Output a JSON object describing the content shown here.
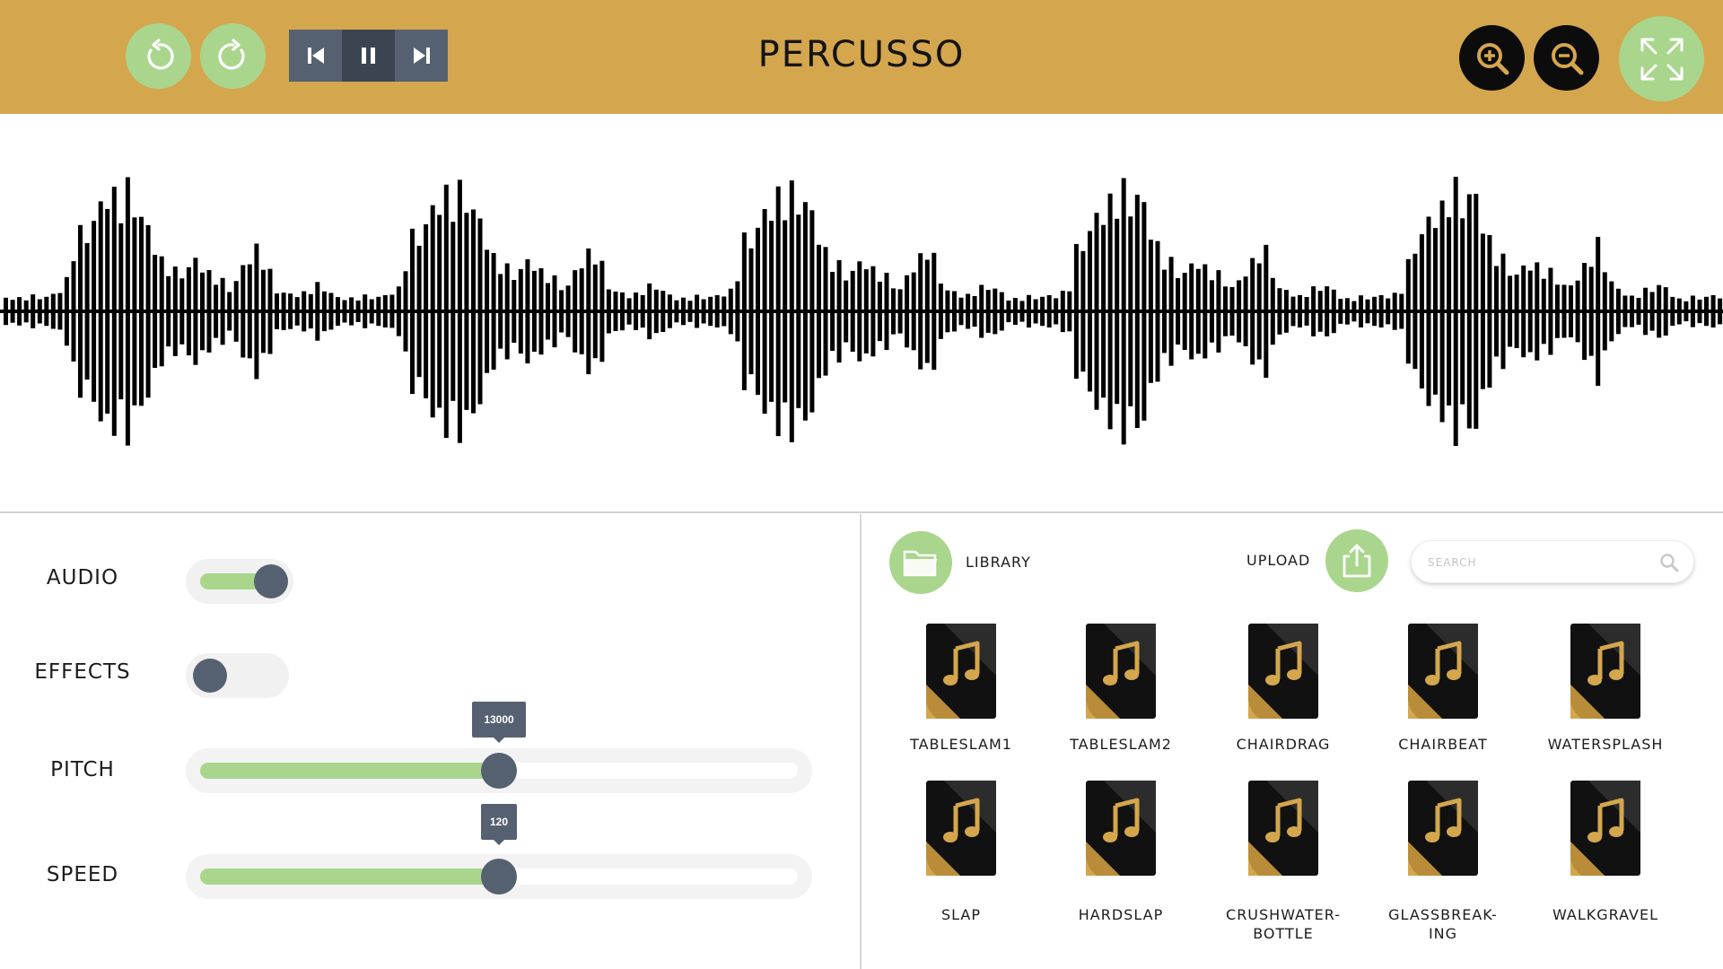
{
  "app": {
    "title": "PERCUSSO"
  },
  "header": {
    "undo_icon": "undo-icon",
    "redo_icon": "redo-icon",
    "transport": [
      "skip-back-icon",
      "pause-icon",
      "skip-forward-icon"
    ],
    "zoom_in_icon": "zoom-in-icon",
    "zoom_out_icon": "zoom-out-icon",
    "fullscreen_icon": "fullscreen-icon"
  },
  "controls": {
    "audio": {
      "label": "AUDIO",
      "on": true
    },
    "effects": {
      "label": "EFFECTS",
      "on": false
    },
    "pitch": {
      "label": "PITCH",
      "value": "13000",
      "fraction": 0.5
    },
    "speed": {
      "label": "SPEED",
      "value": "120",
      "fraction": 0.5
    }
  },
  "library": {
    "library_label": "LIBRARY",
    "upload_label": "UPLOAD",
    "search_placeholder": "SEARCH",
    "files": [
      {
        "label": "TABLESLAM1"
      },
      {
        "label": "TABLESLAM2"
      },
      {
        "label": "CHAIRDRAG"
      },
      {
        "label": "CHAIRBEAT"
      },
      {
        "label": "WATERSPLASH"
      },
      {
        "label": "SLAP"
      },
      {
        "label": "HARDSLAP"
      },
      {
        "label": "CRUSHWATER-\nBOTTLE"
      },
      {
        "label": "GLASSBREAK-\nING"
      },
      {
        "label": "WALKGRAVEL"
      }
    ]
  },
  "colors": {
    "header_bg": "#d4a64e",
    "accent_green": "#a9d68c",
    "slate": "#556170",
    "file_icon_gold": "#d4a64e"
  }
}
